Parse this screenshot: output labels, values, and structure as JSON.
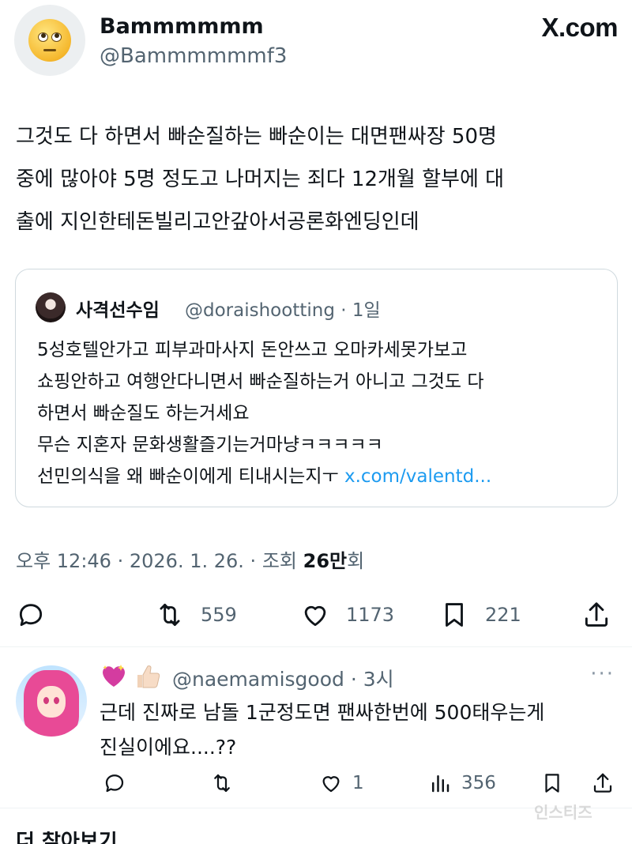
{
  "author": {
    "display_name": "Bammmmmm",
    "handle": "@Bammmmmmf3",
    "avatar_icon": "face-with-rolling-eyes-emoji"
  },
  "brand": "X.com",
  "tweet": {
    "lines": [
      "그것도 다 하면서 빠순질하는 빠순이는 대면팬싸장 50명",
      "중에 많아야 5명 정도고 나머지는 죄다 12개월 할부에 대",
      "출에 지인한테돈빌리고안갚아서공론화엔딩인데"
    ]
  },
  "quote": {
    "name": "사격선수임",
    "handle": "@doraishootting",
    "time": "1일",
    "lines": [
      "5성호텔안가고 피부과마사지 돈안쓰고  오마카세못가보고",
      "쇼핑안하고 여행안다니면서 빠순질하는거 아니고 그것도 다",
      "하면서 빠순질도 하는거세요",
      "무슨 지혼자 문화생활즐기는거마냥ㅋㅋㅋㅋㅋ",
      "선민의식을 왜 빠순이에게 티내시는지ㅜ "
    ],
    "link": "x.com/valentd..."
  },
  "meta": {
    "time": "오후 12:46",
    "date": "2026. 1. 26.",
    "views_prefix": "조회",
    "views": "26만",
    "views_suffix": "회",
    "sep": "·"
  },
  "actions": {
    "reply_count": "",
    "retweet_count": "559",
    "like_count": "1173",
    "bookmark_count": "221"
  },
  "reply": {
    "emojis": [
      "sparkling-heart-emoji",
      "thumbs-up-emoji"
    ],
    "handle": "@naemamisgood",
    "time": "3시",
    "more": "···",
    "lines": [
      "근데 진짜로 남돌 1군정도면 팬싸한번에 500태우는게",
      "진실이에요....??"
    ],
    "retweet_count": "",
    "like_count": "1",
    "views_count": "356"
  },
  "watermark": "인스티즈",
  "next_item_text": "더 찾아보기"
}
